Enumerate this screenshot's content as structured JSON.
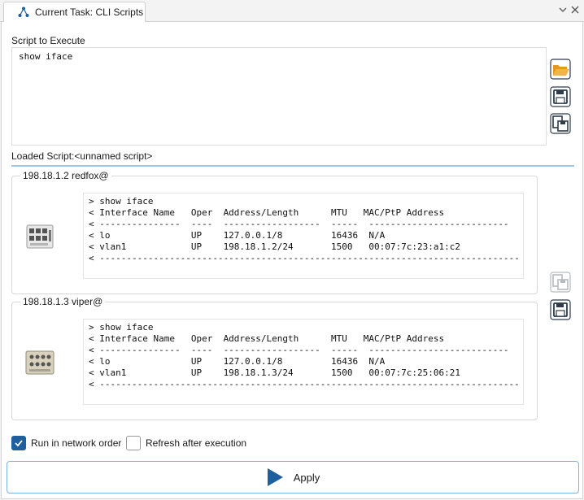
{
  "tab": {
    "title": "Current Task: CLI Scripts"
  },
  "script": {
    "label": "Script to Execute",
    "content": "show iface"
  },
  "loaded": {
    "label": "Loaded Script:<unnamed script>"
  },
  "devices": [
    {
      "title": "198.18.1.2 redfox@",
      "output": "> show iface\n< Interface Name   Oper  Address/Length      MTU   MAC/PtP Address\n< ---------------  ----  ------------------  -----  --------------------------\n< lo               UP    127.0.0.1/8         16436  N/A\n< vlan1            UP    198.18.1.2/24       1500   00:07:7c:23:a1:c2\n< ------------------------------------------------------------------------------"
    },
    {
      "title": "198.18.1.3 viper@",
      "output": "> show iface\n< Interface Name   Oper  Address/Length      MTU   MAC/PtP Address\n< ---------------  ----  ------------------  -----  --------------------------\n< lo               UP    127.0.0.1/8         16436  N/A\n< vlan1            UP    198.18.1.3/24       1500   00:07:7c:25:06:21\n< ------------------------------------------------------------------------------"
    }
  ],
  "options": {
    "run_in_network_order": {
      "label": "Run in network order",
      "checked": true
    },
    "refresh_after_execution": {
      "label": "Refresh after execution",
      "checked": false
    }
  },
  "apply": {
    "label": "Apply"
  },
  "colors": {
    "accent": "#1f5f9e",
    "folder": "#e59a1e",
    "icon_dark": "#2e3b4a",
    "separator": "#9cc6e8"
  },
  "icons": {
    "tab": "network-icon",
    "open": "folder-open-icon",
    "save": "save-icon",
    "save_as": "save-as-icon",
    "apply": "play-icon"
  }
}
